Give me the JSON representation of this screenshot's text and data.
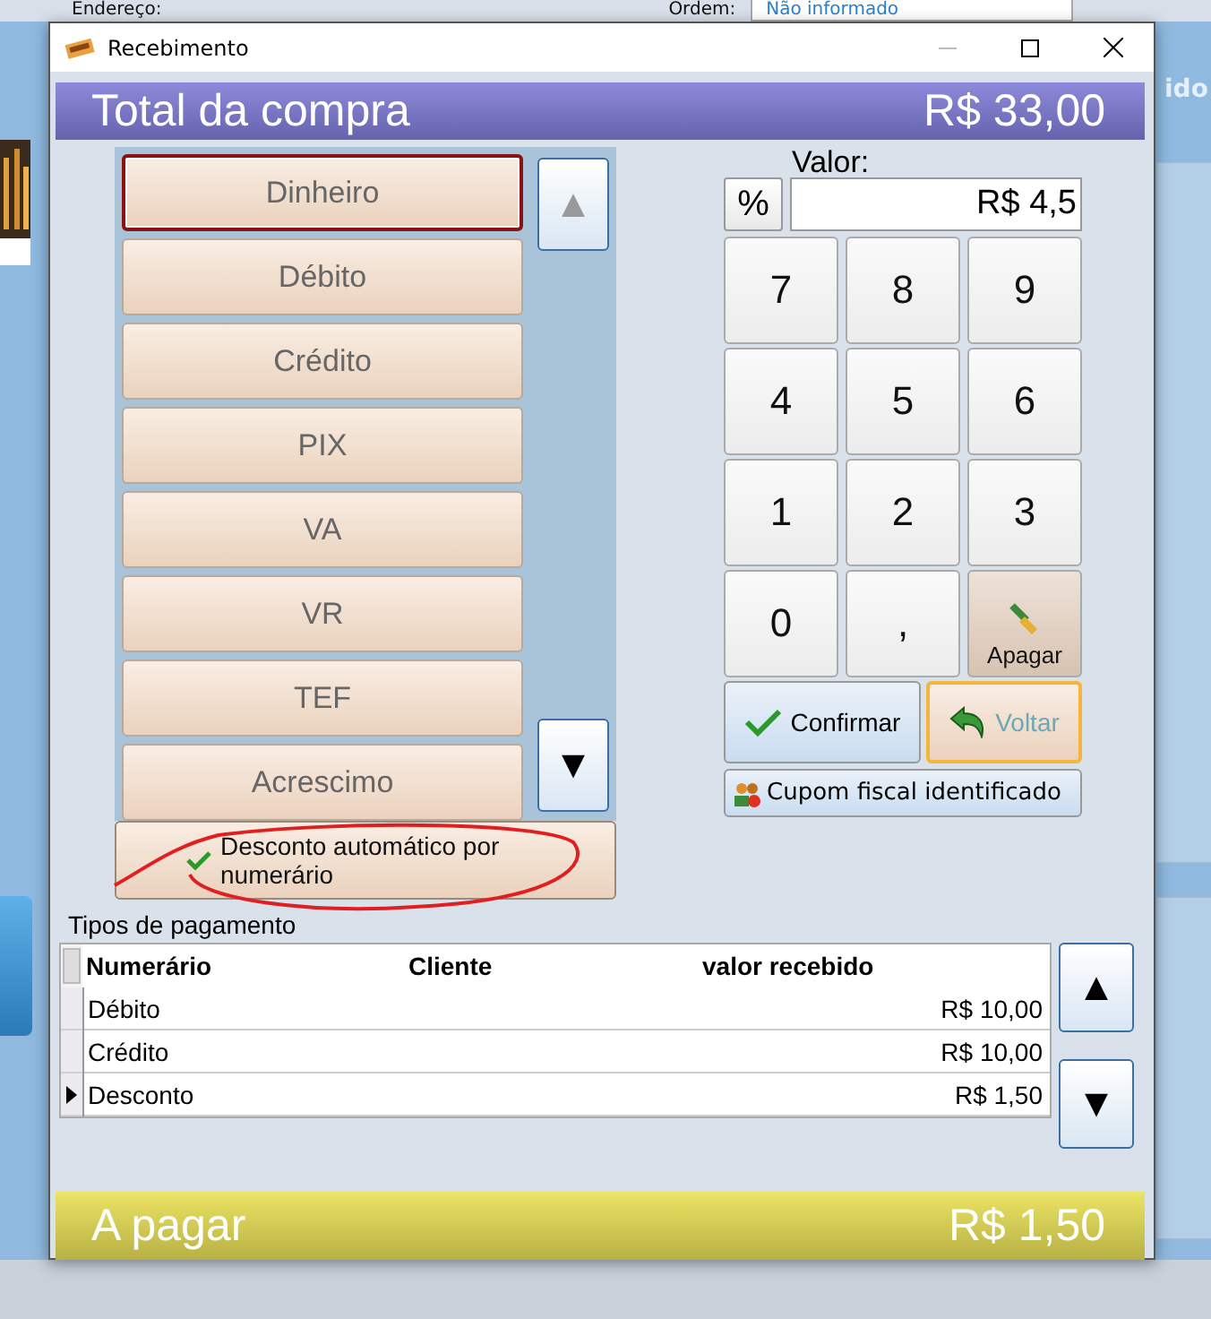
{
  "background": {
    "address_label": "Endereço:",
    "order_label": "Ordem:",
    "order_value": "Não informado",
    "side_text": "ido"
  },
  "window": {
    "title": "Recebimento"
  },
  "total": {
    "label": "Total da compra",
    "amount": "R$ 33,00"
  },
  "payment_methods": [
    {
      "label": "Dinheiro",
      "selected": true
    },
    {
      "label": "Débito",
      "selected": false
    },
    {
      "label": "Crédito",
      "selected": false
    },
    {
      "label": "PIX",
      "selected": false
    },
    {
      "label": "VA",
      "selected": false
    },
    {
      "label": "VR",
      "selected": false
    },
    {
      "label": "TEF",
      "selected": false
    },
    {
      "label": "Acrescimo",
      "selected": false
    }
  ],
  "list_scroll": {
    "up": "▲",
    "down": "▼"
  },
  "auto_discount": {
    "label": "Desconto automático por numerário",
    "checked": true
  },
  "value": {
    "label": "Valor:",
    "percent": "%",
    "value": "R$ 4,5"
  },
  "keypad": [
    {
      "kind": "digit",
      "label": "7"
    },
    {
      "kind": "digit",
      "label": "8"
    },
    {
      "kind": "digit",
      "label": "9"
    },
    {
      "kind": "digit",
      "label": "4"
    },
    {
      "kind": "digit",
      "label": "5"
    },
    {
      "kind": "digit",
      "label": "6"
    },
    {
      "kind": "digit",
      "label": "1"
    },
    {
      "kind": "digit",
      "label": "2"
    },
    {
      "kind": "digit",
      "label": "3"
    },
    {
      "kind": "digit",
      "label": "0"
    },
    {
      "kind": "digit",
      "label": ","
    },
    {
      "kind": "clear",
      "label": "Apagar"
    }
  ],
  "actions": [
    {
      "kind": "confirm",
      "label": "Confirmar",
      "focused": false
    },
    {
      "kind": "back",
      "label": "Voltar",
      "focused": true
    }
  ],
  "coupon_button": "Cupom fiscal identificado",
  "payments_table": {
    "title": "Tipos de pagamento",
    "columns": [
      "Numerário",
      "Cliente",
      "valor recebido"
    ],
    "rows": [
      {
        "method": "Débito",
        "client": "",
        "amount": "R$ 10,00",
        "selected": false
      },
      {
        "method": "Crédito",
        "client": "",
        "amount": "R$ 10,00",
        "selected": false
      },
      {
        "method": "Desconto",
        "client": "",
        "amount": "R$ 1,50",
        "selected": true
      }
    ],
    "scroll_up": "▲",
    "scroll_down": "▼"
  },
  "to_pay": {
    "label": "A pagar",
    "amount": "R$ 1,50"
  }
}
